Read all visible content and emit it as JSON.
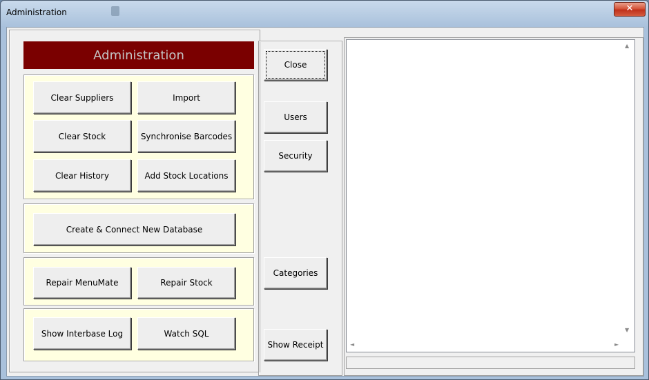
{
  "window": {
    "title": "Administration",
    "close_glyph": "✕"
  },
  "admin_panel": {
    "header": "Administration",
    "header_color": "#7a0000",
    "group_bg": "#ffffe1",
    "maintenance": {
      "clear_suppliers": "Clear Suppliers",
      "import": "Import",
      "clear_stock": "Clear Stock",
      "synchronise_barcodes": "Synchronise Barcodes",
      "clear_history": "Clear History",
      "add_stock_locations": "Add Stock Locations"
    },
    "database": {
      "create_connect": "Create & Connect New Database"
    },
    "repair": {
      "repair_menumate": "Repair MenuMate",
      "repair_stock": "Repair Stock"
    },
    "logs": {
      "show_interbase_log": "Show Interbase Log",
      "watch_sql": "Watch SQL"
    }
  },
  "side_buttons": {
    "close": "Close",
    "users": "Users",
    "security": "Security",
    "categories": "Categories",
    "show_receipt": "Show Receipt"
  },
  "output": {
    "content": "",
    "up_arrow": "▲",
    "down_arrow": "▼",
    "left_arrow": "◄",
    "right_arrow": "►"
  }
}
